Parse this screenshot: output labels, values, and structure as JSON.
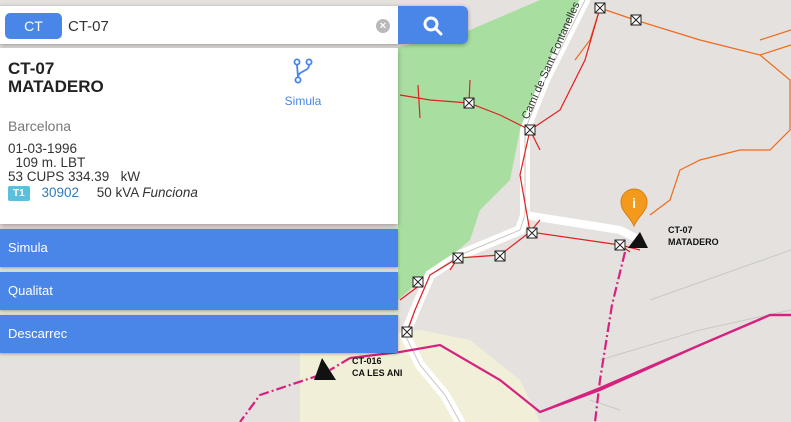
{
  "search": {
    "type_label": "CT",
    "query": "CT-07",
    "clear_icon": "clear-icon",
    "search_icon": "search-icon"
  },
  "card": {
    "code": "CT-07",
    "name": "MATADERO",
    "simula_label": "Simula",
    "simula_icon": "branch-icon",
    "city": "Barcelona",
    "date": "01-03-1996",
    "line_info": "  109 m. LBT",
    "cups_info": "53 CUPS 334.39   kW",
    "transformer": {
      "badge": "T1",
      "id": "30902",
      "power": "50 kVA",
      "status": "Funciona"
    }
  },
  "actions": [
    "Simula",
    "Qualitat",
    "Descarrec"
  ],
  "map": {
    "street_label": "Camí de Sant Fontanelles",
    "stations": [
      {
        "code": "CT-07",
        "name": "MATADERO"
      },
      {
        "code": "CT-016",
        "name": "CA LES ANI"
      }
    ],
    "marker_icon": "info-marker-icon",
    "colors": {
      "lv_line": "#e02020",
      "mv_line": "#d6217f",
      "orange_line": "#f06a1d",
      "green_area": "#a8dfa0",
      "accent": "#4a86e8"
    }
  }
}
